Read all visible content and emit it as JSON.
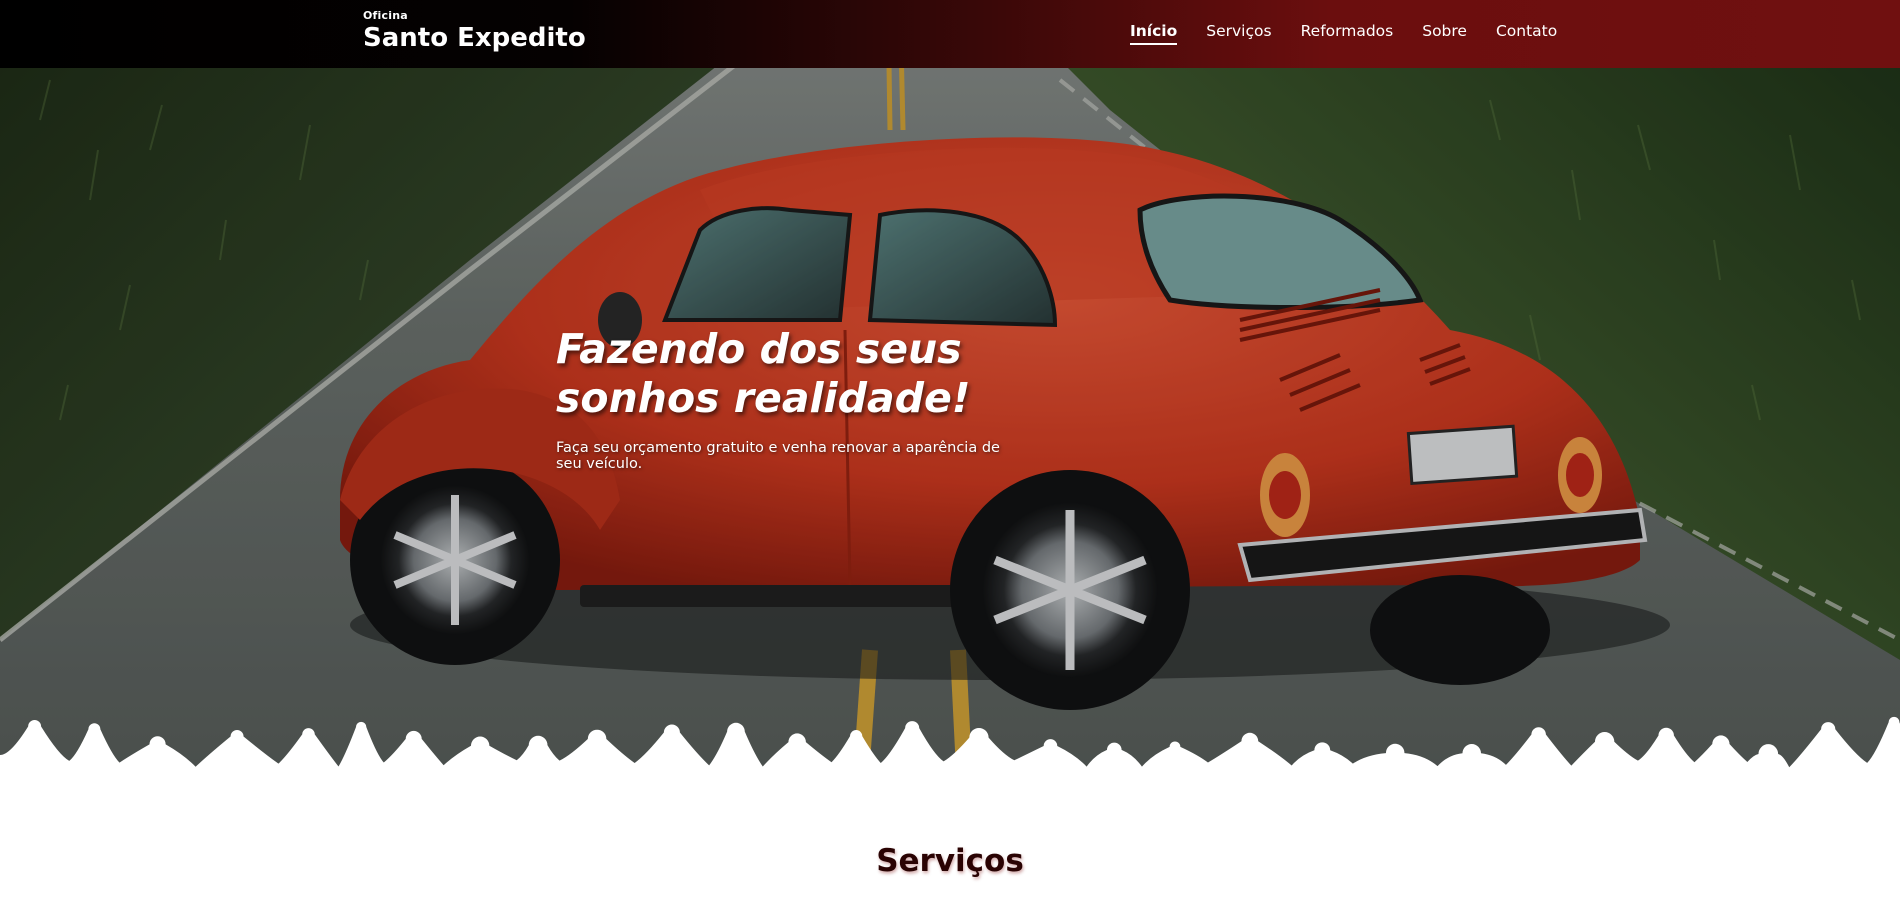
{
  "header": {
    "brand_small": "Oficina",
    "brand_big": "Santo Expedito",
    "nav": [
      {
        "label": "Início",
        "active": true
      },
      {
        "label": "Serviços",
        "active": false
      },
      {
        "label": "Reformados",
        "active": false
      },
      {
        "label": "Sobre",
        "active": false
      },
      {
        "label": "Contato",
        "active": false
      }
    ]
  },
  "hero": {
    "title_line1": "Fazendo dos seus",
    "title_line2": "sonhos realidade!",
    "subtitle": "Faça seu orçamento gratuito e venha renovar a aparência de seu veículo.",
    "image_subject": "red-beetle-car-on-road"
  },
  "services": {
    "title": "Serviços"
  },
  "colors": {
    "header_dark": "#000000",
    "header_red": "#701010",
    "car_red": "#d63a22",
    "title_dark": "#2a0303"
  }
}
